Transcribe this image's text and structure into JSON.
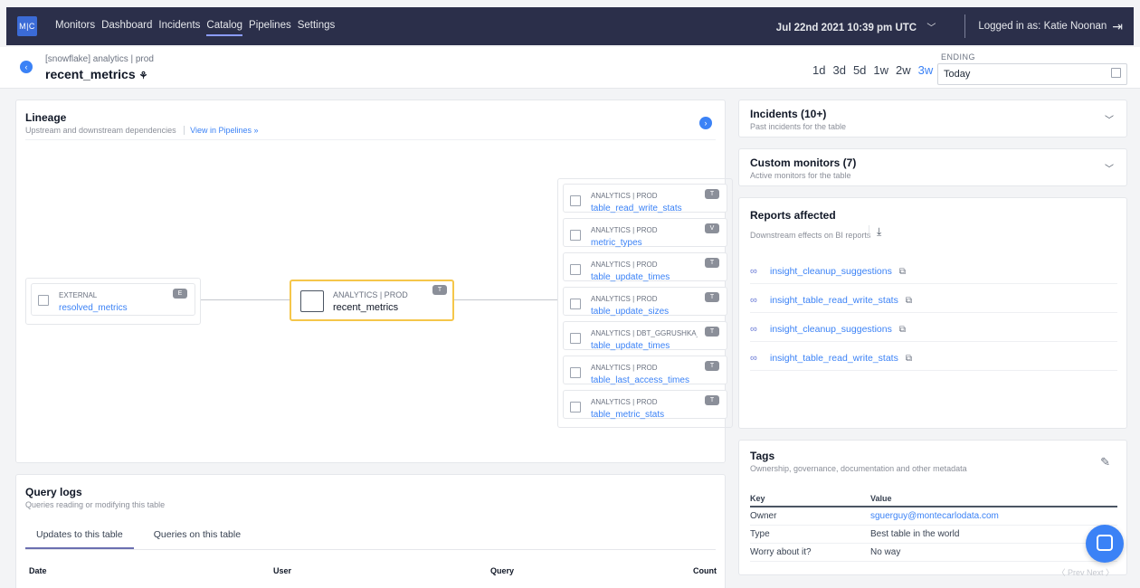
{
  "nav": {
    "logo": "M|C",
    "links": [
      "Monitors",
      "Dashboard",
      "Incidents",
      "Catalog",
      "Pipelines",
      "Settings"
    ],
    "active": "Catalog",
    "date_bold": "Jul 22nd 2021 10:39 pm UTC",
    "logged_in": "Logged in as: Katie Noonan"
  },
  "header": {
    "breadcrumb": "[snowflake] analytics | prod",
    "table_name": "recent_metrics",
    "ranges": [
      "1d",
      "3d",
      "5d",
      "1w",
      "2w",
      "3w"
    ],
    "active_range": "3w",
    "ending_label": "ENDING",
    "ending_value": "Today"
  },
  "lineage": {
    "title": "Lineage",
    "subtitle": "Upstream and downstream dependencies",
    "link": "View in Pipelines »",
    "upstream": {
      "schema": "EXTERNAL",
      "name": "resolved_metrics",
      "badge": "E"
    },
    "center": {
      "schema": "ANALYTICS | PROD",
      "name": "recent_metrics",
      "badge": "T"
    },
    "downstream": [
      {
        "schema": "ANALYTICS | PROD",
        "name": "table_read_write_stats",
        "badge": "T"
      },
      {
        "schema": "ANALYTICS | PROD",
        "name": "metric_types",
        "badge": "V"
      },
      {
        "schema": "ANALYTICS | PROD",
        "name": "table_update_times",
        "badge": "T"
      },
      {
        "schema": "ANALYTICS | PROD",
        "name": "table_update_sizes",
        "badge": "T"
      },
      {
        "schema": "ANALYTICS | DBT_GGRUSHKA_...",
        "name": "table_update_times",
        "badge": "T"
      },
      {
        "schema": "ANALYTICS | PROD",
        "name": "table_last_access_times",
        "badge": "T"
      },
      {
        "schema": "ANALYTICS | PROD",
        "name": "table_metric_stats",
        "badge": "T"
      }
    ]
  },
  "incidents": {
    "title": "Incidents (10+)",
    "subtitle": "Past incidents for the table"
  },
  "custom_monitors": {
    "title": "Custom monitors (7)",
    "subtitle": "Active monitors for the table"
  },
  "reports": {
    "title": "Reports affected",
    "subtitle": "Downstream effects on BI reports",
    "items": [
      "insight_cleanup_suggestions",
      "insight_table_read_write_stats",
      "insight_cleanup_suggestions",
      "insight_table_read_write_stats"
    ]
  },
  "tags": {
    "title": "Tags",
    "subtitle": "Ownership, governance, documentation and other metadata",
    "columns": [
      "Key",
      "Value"
    ],
    "rows": [
      {
        "key": "Owner",
        "value": "sguerguy@montecarlodata.com"
      },
      {
        "key": "Type",
        "value": "Best table in the world"
      },
      {
        "key": "Worry about it?",
        "value": "No way"
      }
    ],
    "pager": "〈 Prev  Next 〉"
  },
  "query_logs": {
    "title": "Query logs",
    "subtitle": "Queries reading or modifying this table",
    "tabs": [
      "Updates to this table",
      "Queries on this table"
    ],
    "columns": [
      "Date",
      "User",
      "Query",
      "Count"
    ]
  }
}
